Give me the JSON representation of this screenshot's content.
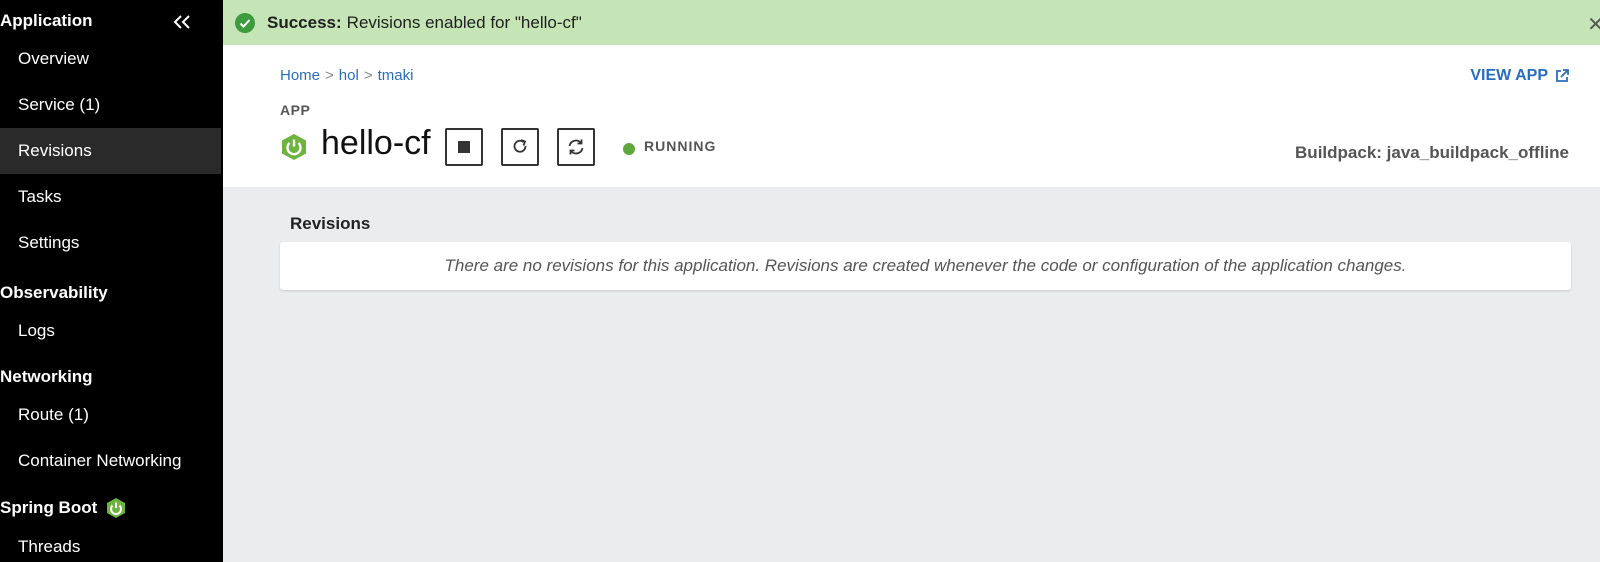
{
  "sidebar": {
    "sections": [
      {
        "title": "Application",
        "items": [
          "Overview",
          "Service (1)",
          "Revisions",
          "Tasks",
          "Settings"
        ]
      },
      {
        "title": "Observability",
        "items": [
          "Logs"
        ]
      },
      {
        "title": "Networking",
        "items": [
          "Route (1)",
          "Container Networking"
        ]
      },
      {
        "title": "Spring Boot",
        "items": [
          "Threads"
        ]
      }
    ],
    "active_item": "Revisions",
    "collapse_icon": "double-chevron-left-icon"
  },
  "banner": {
    "strong": "Success:",
    "message": "Revisions enabled for \"hello-cf\"",
    "color": "#c6e5b6",
    "icon": "check-circle-icon"
  },
  "breadcrumb": [
    "Home",
    "hol",
    "tmaki"
  ],
  "app": {
    "label": "APP",
    "name": "hello-cf",
    "status": "RUNNING",
    "status_color": "#5fa83e",
    "view_app": "VIEW APP",
    "buildpack": "Buildpack: java_buildpack_offline"
  },
  "revisions": {
    "title": "Revisions",
    "empty_message": "There are no revisions for this application. Revisions are created whenever the code or configuration of the application changes."
  }
}
